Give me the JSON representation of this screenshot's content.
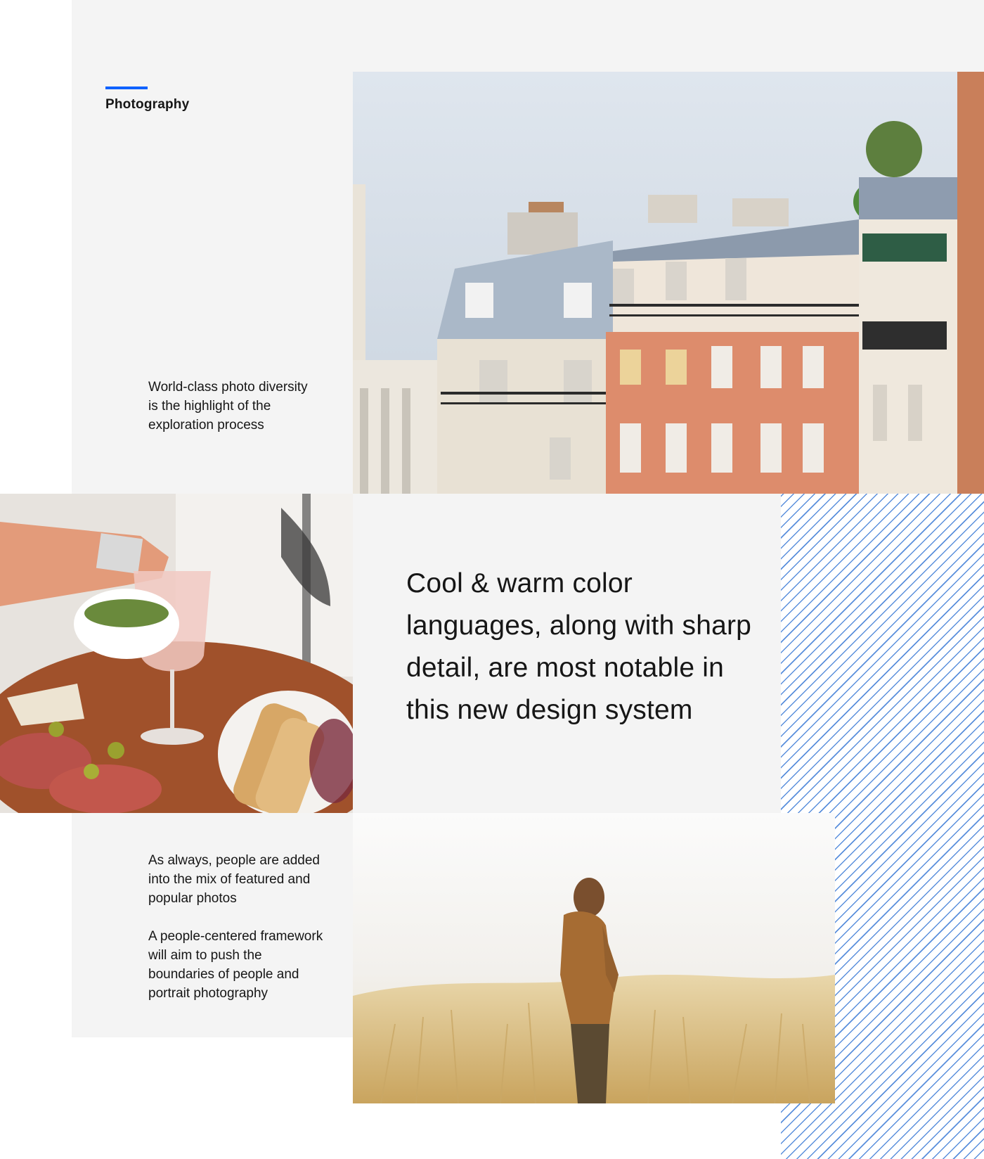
{
  "section": {
    "eyebrow": "Photography",
    "accent_color": "#0f62fe"
  },
  "intro": {
    "copy": "World-class photo diversity is the highlight of the exploration process"
  },
  "feature": {
    "headline": "Cool & warm color languages, along with sharp detail, are most notable in this new design system"
  },
  "people": {
    "copy_1": "As always, people are added into the mix of featured and popular photos",
    "copy_2": "A people-centered framework will aim to push the boundaries of people and portrait photography"
  },
  "images": [
    {
      "name": "parisian-apartment-buildings-photo"
    },
    {
      "name": "rose-wine-charcuterie-photo"
    },
    {
      "name": "person-in-wheat-field-photo"
    }
  ]
}
